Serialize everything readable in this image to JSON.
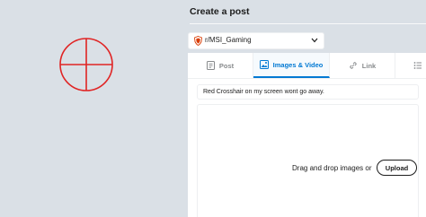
{
  "page": {
    "title": "Create a post"
  },
  "community": {
    "name": "r/MSI_Gaming"
  },
  "tabs": [
    {
      "label": "Post",
      "icon": "document-icon"
    },
    {
      "label": "Images & Video",
      "icon": "image-icon"
    },
    {
      "label": "Link",
      "icon": "link-icon"
    },
    {
      "label": "",
      "icon": "poll-icon"
    }
  ],
  "active_tab": "Images & Video",
  "post": {
    "title_value": "Red Crosshair on my screen wont go away."
  },
  "upload": {
    "prompt": "Drag and drop images or",
    "button_label": "Upload"
  },
  "colors": {
    "crosshair": "#e02424",
    "accent": "#0079d3",
    "background": "#dae0e6"
  }
}
